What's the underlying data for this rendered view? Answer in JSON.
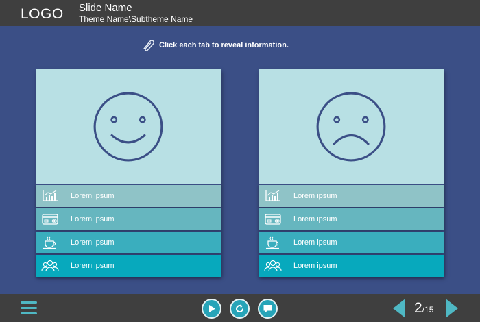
{
  "header": {
    "logo": "LOGO",
    "slide_name": "Slide Name",
    "theme_name": "Theme Name\\Subtheme Name"
  },
  "instruction": {
    "text": "Click each tab to reveal information.",
    "icon": "paperclip-icon"
  },
  "cards": [
    {
      "face": "smiley-face-icon",
      "tabs": [
        {
          "label": "Lorem ipsum",
          "icon": "chart-icon"
        },
        {
          "label": "Lorem ipsum",
          "icon": "credit-card-icon"
        },
        {
          "label": "Lorem ipsum",
          "icon": "coffee-cup-icon"
        },
        {
          "label": "Lorem ipsum",
          "icon": "group-icon"
        }
      ]
    },
    {
      "face": "sad-face-icon",
      "tabs": [
        {
          "label": "Lorem ipsum",
          "icon": "chart-icon"
        },
        {
          "label": "Lorem ipsum",
          "icon": "credit-card-icon"
        },
        {
          "label": "Lorem ipsum",
          "icon": "coffee-cup-icon"
        },
        {
          "label": "Lorem ipsum",
          "icon": "group-icon"
        }
      ]
    }
  ],
  "footer": {
    "current_page": "2",
    "total_pages": "/15",
    "buttons": [
      "menu-icon",
      "play-icon",
      "replay-icon",
      "chat-icon",
      "prev-arrow-icon",
      "next-arrow-icon"
    ]
  },
  "colors": {
    "background": "#3b4f86",
    "bars": "#3f3f3f",
    "accent": "#27a4b8",
    "face_panel": "#b8e0e4",
    "tab1": "#8fc3c7",
    "tab2": "#66b6bf",
    "tab3": "#3aaebe",
    "tab4": "#07a9bd"
  }
}
